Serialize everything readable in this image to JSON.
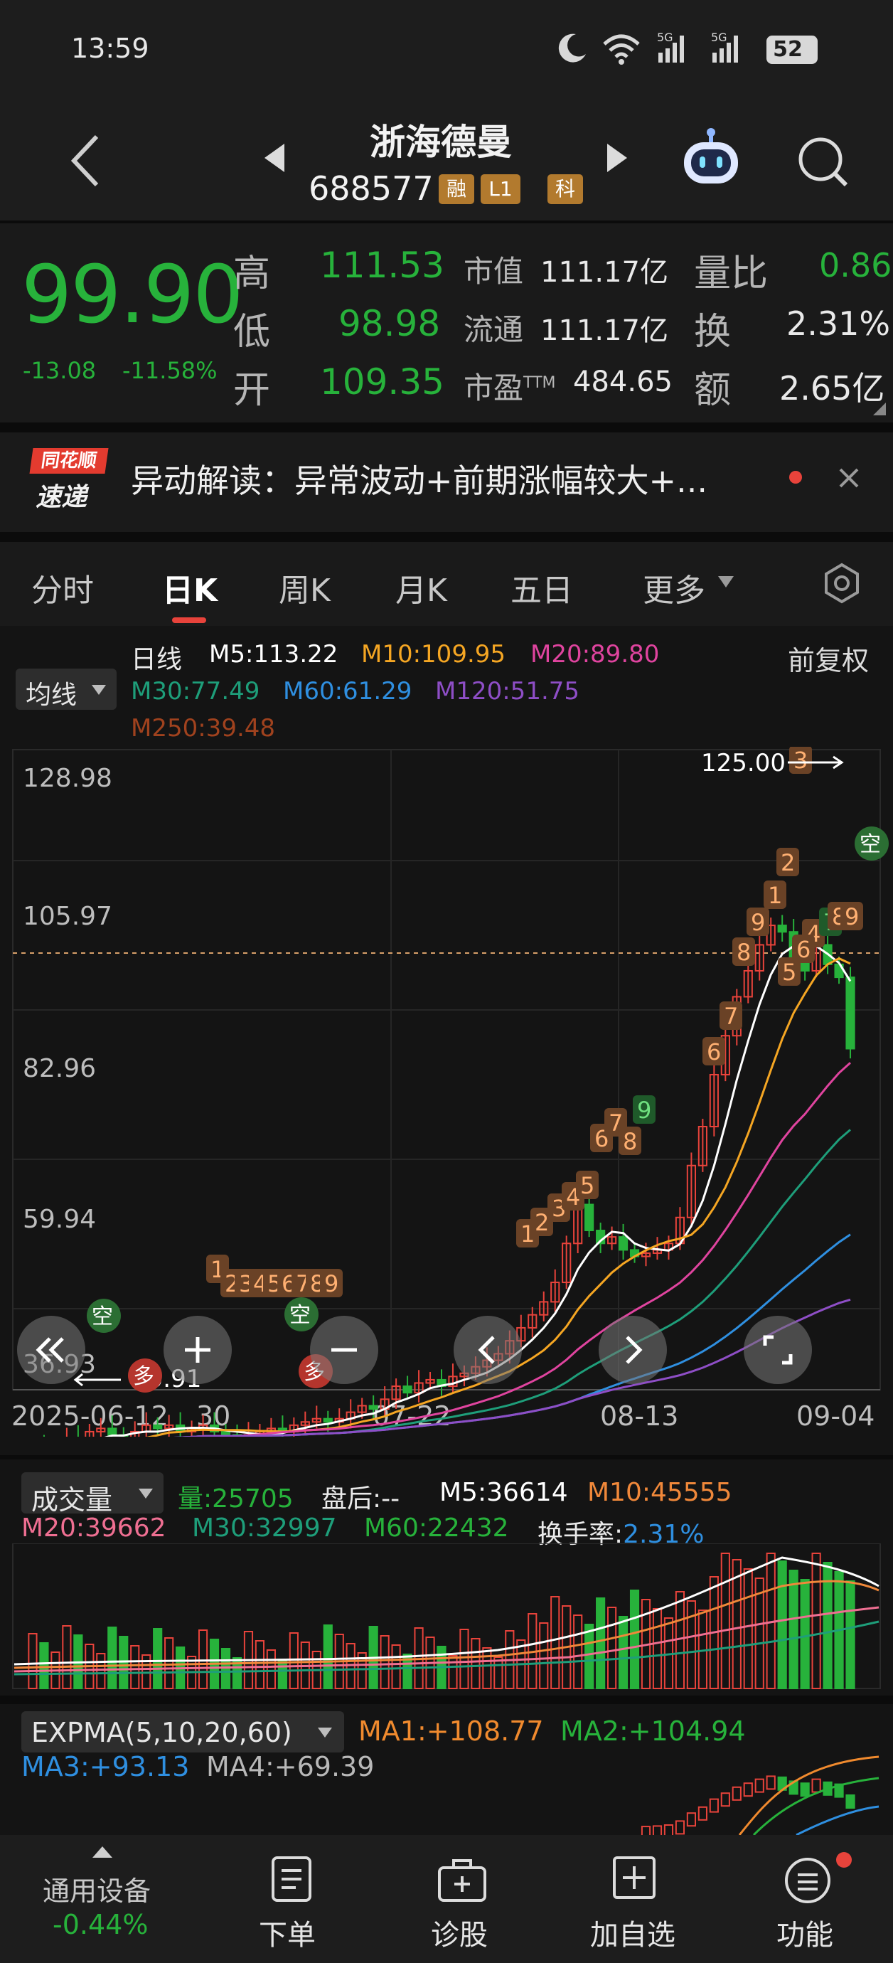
{
  "status_bar": {
    "time": "13:59",
    "battery": "52",
    "net1": "5G",
    "net2": "5G"
  },
  "header": {
    "name": "浙海德曼",
    "code": "688577",
    "tag1": "融",
    "tag2": "L1",
    "tag3": "科"
  },
  "quote": {
    "price": "99.90",
    "change": "-13.08",
    "change_pct": "-11.58%",
    "high_label": "高",
    "high": "111.53",
    "low_label": "低",
    "low": "98.98",
    "open_label": "开",
    "open": "109.35",
    "mktcap_label": "市值",
    "mktcap": "111.17亿",
    "float_label": "流通",
    "float": "111.17亿",
    "pe_label": "市盈",
    "pe_sup": "TTM",
    "pe": "484.65",
    "volratio_label": "量比",
    "volratio": "0.86",
    "turnover_label": "换",
    "turnover": "2.31%",
    "amount_label": "额",
    "amount": "2.65亿"
  },
  "banner": {
    "logo_top": "同花顺",
    "logo_bottom": "速递",
    "text": "异动解读：异常波动+前期涨幅较大+..."
  },
  "tabs": [
    "分时",
    "日K",
    "周K",
    "月K",
    "五日",
    "更多"
  ],
  "ma_legend": {
    "selector": "均线",
    "period": "日线",
    "adjust": "前复权",
    "m5": "M5:113.22",
    "m10": "M10:109.95",
    "m20": "M20:89.80",
    "m30": "M30:77.49",
    "m60": "M60:61.29",
    "m120": "M120:51.75",
    "m250": "M250:39.48"
  },
  "kline": {
    "y_labels": [
      "128.98",
      "105.97",
      "82.96",
      "59.94",
      "36.93"
    ],
    "x_labels": [
      "2025-06-12",
      "30",
      "07-22",
      "08-13",
      "09-04"
    ],
    "high_mark": "125.00",
    "low_mark": "40.91",
    "signals": [
      "1",
      "2",
      "3",
      "4",
      "5",
      "6",
      "7",
      "8",
      "9",
      "1",
      "2",
      "3",
      "4",
      "5",
      "6",
      "7",
      "8",
      "9",
      "6",
      "7",
      "8",
      "9",
      "1",
      "2",
      "3",
      "4",
      "5",
      "6",
      "7",
      "8",
      "9"
    ],
    "kong": "空",
    "duo": "多"
  },
  "volume": {
    "selector": "成交量",
    "vol": "量:25705",
    "after": "盘后:--",
    "m5": "M5:36614",
    "m10": "M10:45555",
    "m20": "M20:39662",
    "m30": "M30:32997",
    "m60": "M60:22432",
    "turnover": "换手率:",
    "turnover_val": "2.31%"
  },
  "expma": {
    "selector": "EXPMA(5,10,20,60)",
    "ma1": "MA1:+108.77",
    "ma2": "MA2:+104.94",
    "ma3": "MA3:+93.13",
    "ma4": "MA4:+69.39"
  },
  "bottom_nav": {
    "index_name": "通用设备",
    "index_change": "-0.44%",
    "items": [
      "下单",
      "诊股",
      "加自选",
      "功能"
    ]
  },
  "colors": {
    "up": "#e8433b",
    "down": "#27b23b",
    "m5": "#ffffff",
    "m10": "#f5a623",
    "m20": "#e0449f",
    "m30": "#1e9e7a",
    "m60": "#2f8fe0",
    "m120": "#8e4ec6",
    "m250": "#a0421e"
  }
}
